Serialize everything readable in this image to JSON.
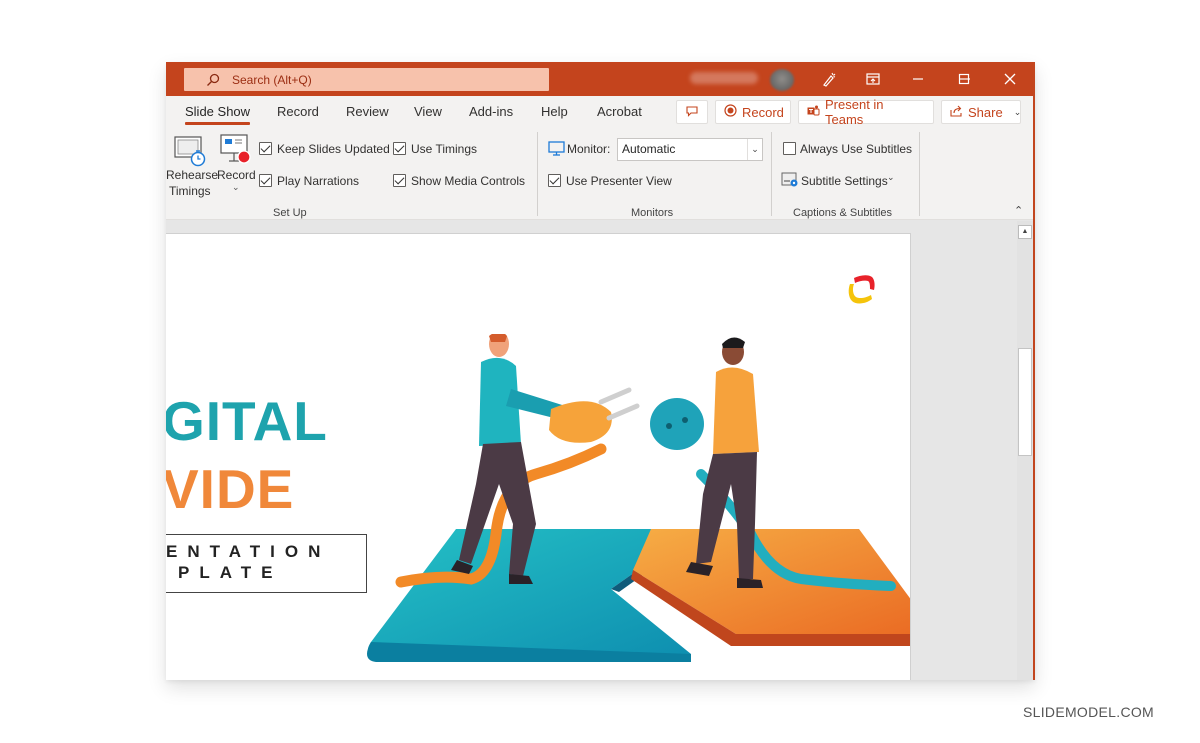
{
  "titlebar": {
    "search_placeholder": "Search (Alt+Q)",
    "accent_color": "#c4441d",
    "buttons": [
      "designer-icon",
      "ribbon-display-icon",
      "minimize-icon",
      "maximize-icon",
      "close-icon"
    ]
  },
  "tabs": [
    {
      "label": "Slide Show",
      "active": true
    },
    {
      "label": "Record",
      "active": false
    },
    {
      "label": "Review",
      "active": false
    },
    {
      "label": "View",
      "active": false
    },
    {
      "label": "Add-ins",
      "active": false
    },
    {
      "label": "Help",
      "active": false
    },
    {
      "label": "Acrobat",
      "active": false
    }
  ],
  "header_buttons": {
    "comments_icon": "comment-icon",
    "record": "Record",
    "present_in_teams": "Present in Teams",
    "share": "Share"
  },
  "ribbon": {
    "setup": {
      "group_label": "Set Up",
      "rehearse_line1": "Rehearse",
      "rehearse_line2": "Timings",
      "record_label": "Record",
      "checkboxes": [
        {
          "label": "Keep Slides Updated",
          "checked": true
        },
        {
          "label": "Use Timings",
          "checked": true
        },
        {
          "label": "Play Narrations",
          "checked": true
        },
        {
          "label": "Show Media Controls",
          "checked": true
        }
      ]
    },
    "monitors": {
      "group_label": "Monitors",
      "monitor_label": "Monitor:",
      "monitor_value": "Automatic",
      "presenter_view": {
        "label": "Use Presenter View",
        "checked": true
      }
    },
    "captions": {
      "group_label": "Captions & Subtitles",
      "always_use_subtitles": {
        "label": "Always Use Subtitles",
        "checked": false
      },
      "subtitle_settings": "Subtitle Settings"
    }
  },
  "slide": {
    "title_line1": "GITAL",
    "title_line2": "VIDE",
    "subtitle_line1": "ENTATION",
    "subtitle_line2": "PLATE",
    "colors": {
      "teal": "#1ea3ad",
      "orange": "#f0883a"
    }
  },
  "watermark": "SLIDEMODEL.COM"
}
